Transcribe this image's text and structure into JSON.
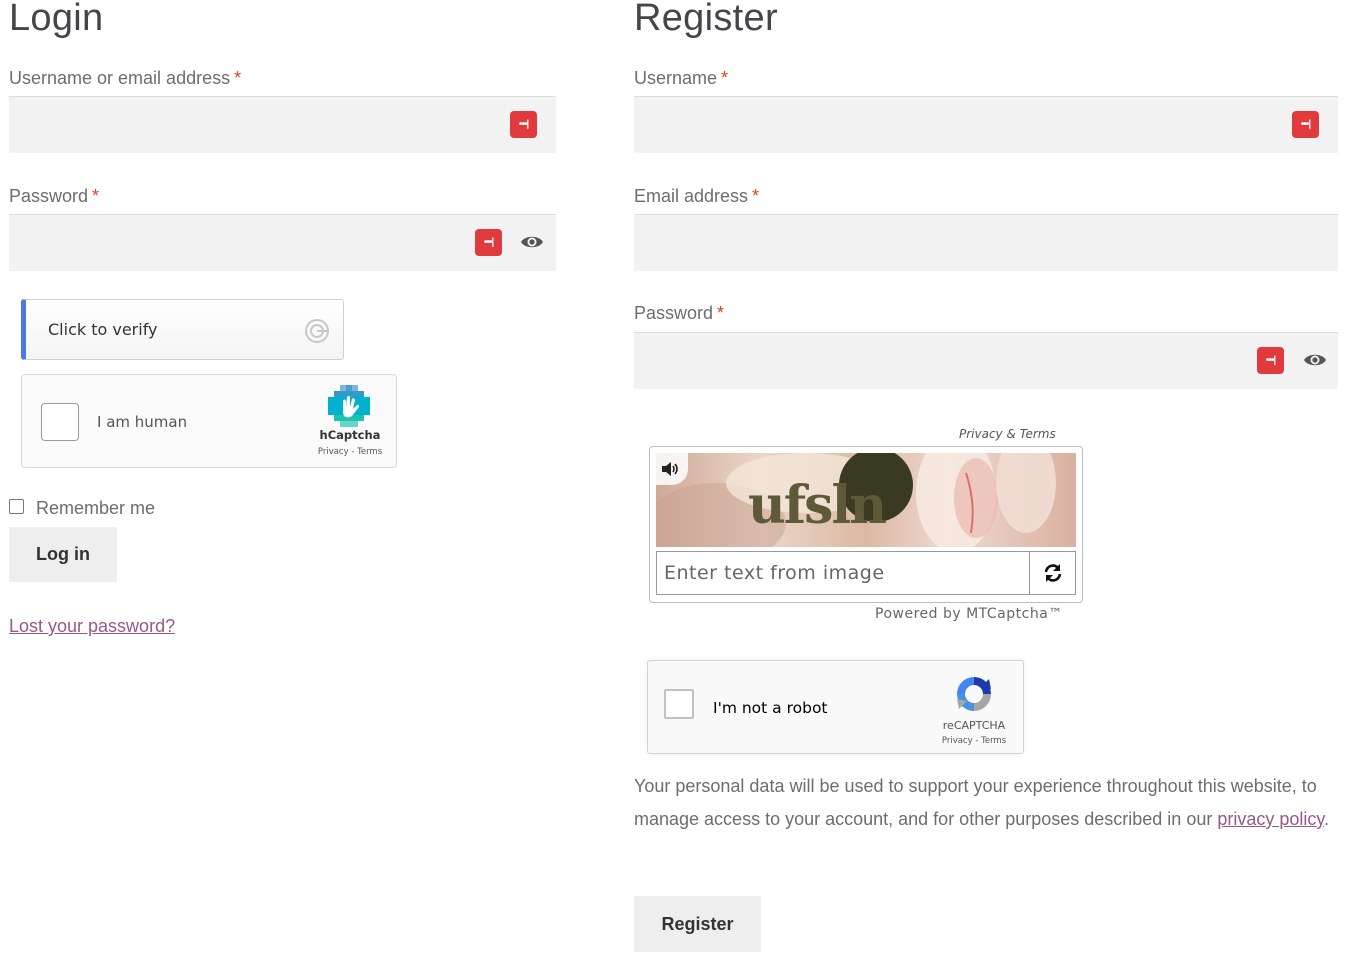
{
  "login": {
    "title": "Login",
    "username_label": "Username or email address",
    "required_mark": "*",
    "password_label": "Password",
    "hcaptcha_verify": {
      "label": "Click to verify"
    },
    "hcaptcha": {
      "checkbox_label": "I am human",
      "brand": "hCaptcha",
      "links": "Privacy - Terms"
    },
    "remember_label": "Remember me",
    "login_button": "Log in",
    "lost_password": "Lost your password?"
  },
  "register": {
    "title": "Register",
    "username_label": "Username",
    "email_label": "Email address",
    "password_label": "Password",
    "required_mark": "*",
    "mtcaptcha": {
      "privacy_terms": "Privacy & Terms",
      "captcha_text": "ufsln",
      "input_placeholder": "Enter text from image",
      "powered_by": "Powered by MTCaptcha™"
    },
    "recaptcha": {
      "checkbox_label": "I'm not a robot",
      "brand": "reCAPTCHA",
      "links": "Privacy - Terms"
    },
    "privacy_text_before": "Your personal data will be used to support your experience throughout this website, to manage access to your account, and for other purposes described in our ",
    "privacy_link": "privacy policy",
    "privacy_text_after": ".",
    "register_button": "Register"
  },
  "colors": {
    "required": "#e2401c",
    "link": "#96588a",
    "password_manager_icon": "#e0393e",
    "hcaptcha_accent": "#4a78e6"
  },
  "icons": [
    "password-manager-icon",
    "eye-icon",
    "hcaptcha-loading-icon",
    "hcaptcha-logo-icon",
    "speaker-icon",
    "refresh-icon",
    "recaptcha-logo-icon"
  ]
}
